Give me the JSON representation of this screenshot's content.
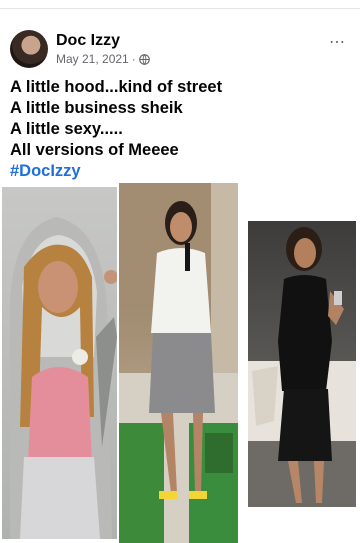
{
  "post": {
    "author": "Doc Izzy",
    "date": "May 21, 2021",
    "separator": "·",
    "more_icon": "⋯",
    "caption": [
      "A little hood...kind of street",
      "A little business sheik",
      "A little sexy.....",
      "All versions of Meeee"
    ],
    "hashtag": "#DocIzzy"
  },
  "photos": [
    {
      "icon": "photo-hooded-sweatshirt"
    },
    {
      "icon": "photo-speaker-on-stage"
    },
    {
      "icon": "photo-black-dress"
    }
  ],
  "colors": {
    "link": "#216fdb",
    "meta": "#65676b",
    "text": "#050505"
  }
}
